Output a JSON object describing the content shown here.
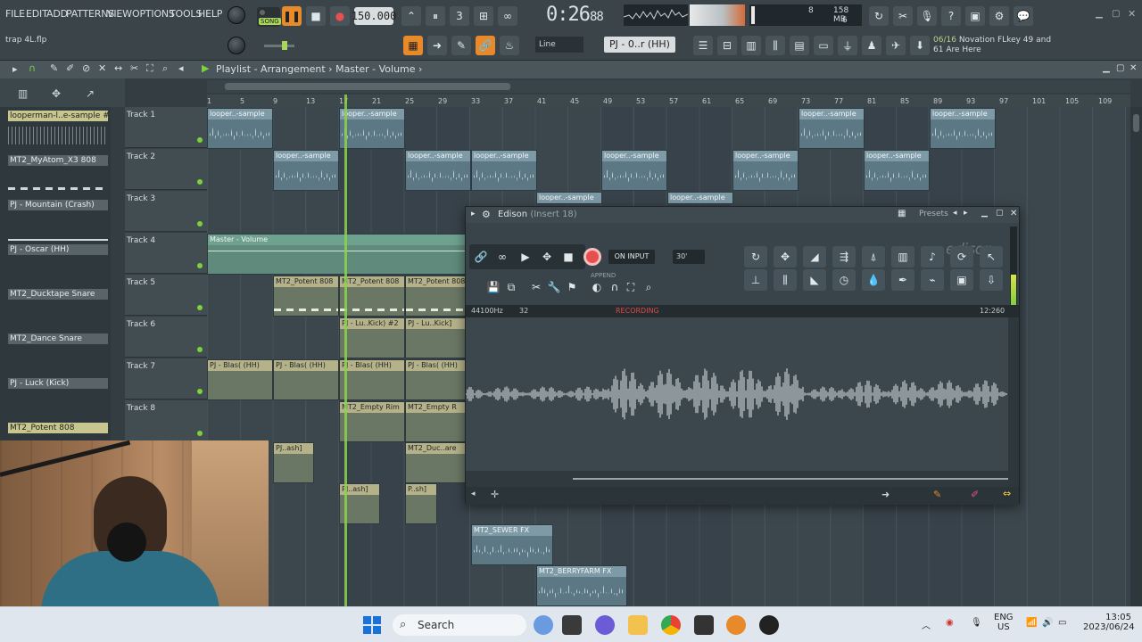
{
  "app": {
    "menu": [
      "FILE",
      "EDIT",
      "ADD",
      "PATTERNS",
      "VIEW",
      "OPTIONS",
      "TOOLS",
      "HELP"
    ],
    "song_label": "SONG",
    "tempo": "150.000",
    "time": "0:26",
    "time_sub": "88",
    "cpu_value": "8",
    "memory": "158 MB",
    "poly": "6",
    "project_file": "trap 4L.flp",
    "snap_mode": "Line",
    "pattern_name": "PJ - 0..r (HH)",
    "midi_counter": "06/16",
    "midi_device": "Novation FLkey 49 and",
    "midi_message": "61 Are Here"
  },
  "playlist": {
    "title": "Playlist - Arrangement",
    "subtitle": "Master - Volume",
    "ruler": [
      "1",
      "5",
      "9",
      "13",
      "17",
      "21",
      "25",
      "29",
      "33",
      "37",
      "41",
      "45",
      "49",
      "53",
      "57",
      "61",
      "65",
      "69",
      "73",
      "77",
      "81",
      "85",
      "89",
      "93",
      "97",
      "101",
      "105",
      "109"
    ],
    "tracks": [
      "Track 1",
      "Track 2",
      "Track 3",
      "Track 4",
      "Track 5",
      "Track 6",
      "Track 7",
      "Track 8"
    ],
    "picker": [
      "looperman-l..e-sample #2",
      "MT2_MyAtom_X3 808",
      "PJ - Mountain (Crash)",
      "PJ - Oscar (HH)",
      "MT2_Ducktape Snare",
      "MT2_Dance Snare",
      "PJ - Luck (Kick)",
      "MT2_Potent 808"
    ],
    "clip_labels": {
      "sample": "looper..-sample",
      "automation": "Master - Volume",
      "potent": "MT2_Potent 808",
      "kick": "PJ - Lu..Kick) #2",
      "kick2": "PJ - Lu..Kick]",
      "hh": "PJ - Blas( (HH)",
      "empty_rim": "MT2_Empty Rim",
      "empty_rim2": "MT2_Empty R",
      "pj_ash": "PJ..ash]",
      "duc": "MT2_Duc..are",
      "pj_ash2": "PJ..ash]",
      "psh": "P..sh]",
      "sewer": "MT2_SEWER FX",
      "berry": "MT2_BERRYFARM FX"
    }
  },
  "edison": {
    "title": "Edison",
    "insert": "(Insert 18)",
    "presets": "Presets",
    "on_input": "ON INPUT",
    "for_value": "30'",
    "append": "APPEND",
    "logo": "edison",
    "sample_rate": "44100Hz",
    "bits": "32",
    "status": "RECORDING",
    "length": "12:260"
  },
  "taskbar": {
    "search": "Search",
    "lang": "ENG",
    "region": "US",
    "time": "13:05",
    "date": "2023/06/24"
  }
}
